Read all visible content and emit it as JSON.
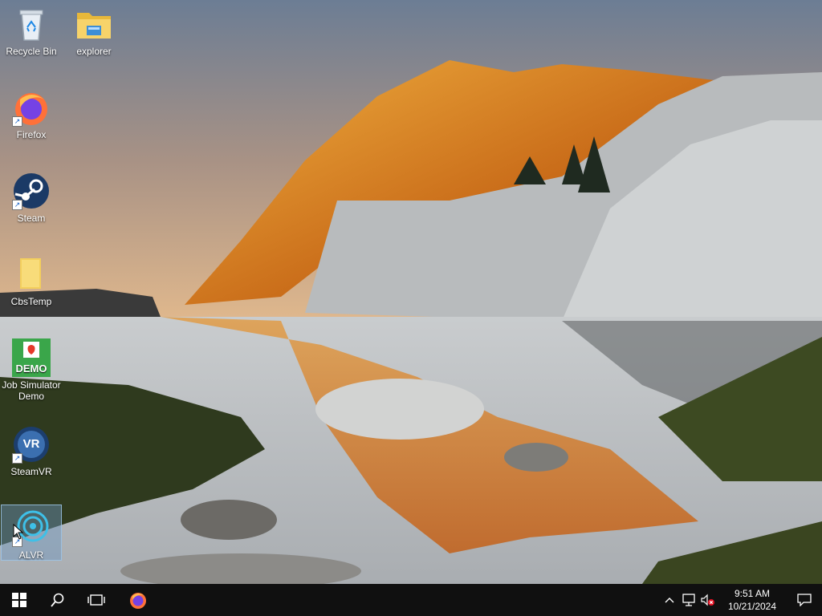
{
  "desktop": {
    "icons": [
      {
        "label": "Recycle Bin",
        "icon": "recycle-bin-icon"
      },
      {
        "label": "explorer",
        "icon": "folder-icon"
      },
      {
        "label": "Firefox",
        "icon": "firefox-icon"
      },
      {
        "label": "Steam",
        "icon": "steam-icon"
      },
      {
        "label": "CbsTemp",
        "icon": "folder-icon"
      },
      {
        "label": "Job Simulator Demo",
        "icon": "job-simulator-icon"
      },
      {
        "label": "SteamVR",
        "icon": "steamvr-icon"
      },
      {
        "label": "ALVR",
        "icon": "alvr-icon"
      }
    ],
    "job_sim_logo_text": "DEMO",
    "steamvr_logo_text": "VR"
  },
  "taskbar": {
    "start": "windows-start-icon",
    "search": "search-icon",
    "task_view": "task-view-icon",
    "pinned": [
      "firefox-icon"
    ]
  },
  "tray": {
    "time": "9:51 AM",
    "date": "10/21/2024",
    "icons": [
      "chevron-up-icon",
      "network-icon",
      "volume-muted-icon",
      "notification-icon"
    ]
  },
  "colors": {
    "taskbar_bg": "#101010",
    "selection": "#6e96be"
  }
}
